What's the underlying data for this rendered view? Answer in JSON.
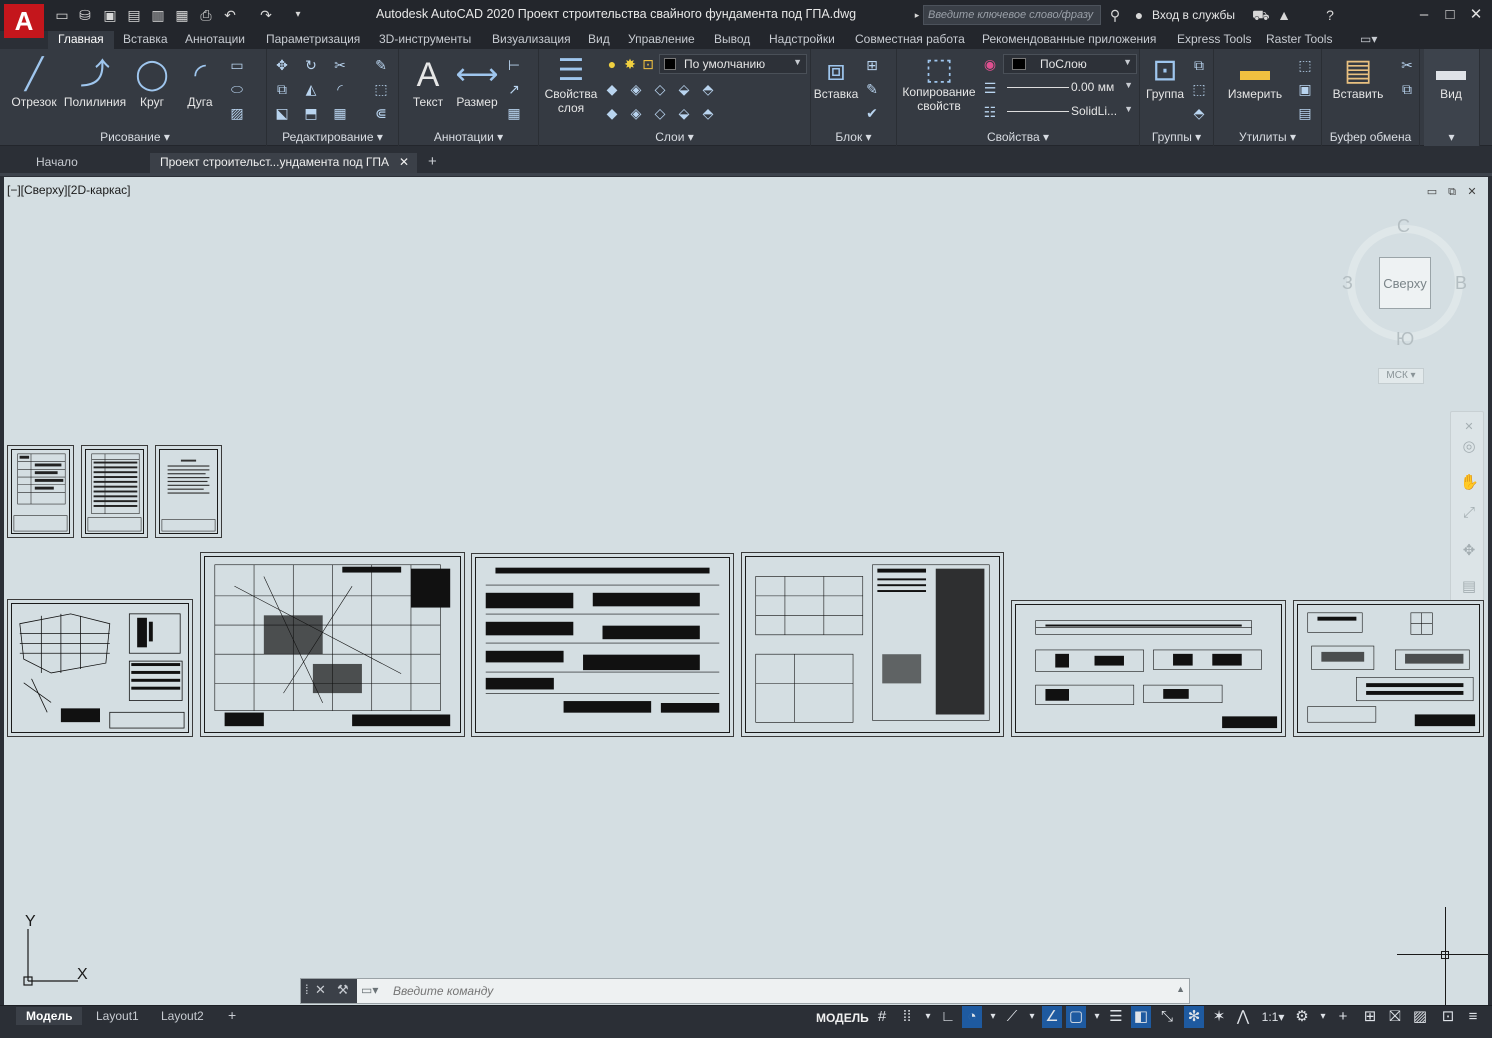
{
  "titlebar": {
    "app_logo": "A",
    "title": "Autodesk AutoCAD 2020   Проект строительства свайного фундамента под ГПА.dwg",
    "search_placeholder": "Введите ключевое слово/фразу",
    "sign_in": "Вход в службы"
  },
  "ribbon_tabs": [
    "Главная",
    "Вставка",
    "Аннотации",
    "Параметризация",
    "3D-инструменты",
    "Визуализация",
    "Вид",
    "Управление",
    "Вывод",
    "Надстройки",
    "Совместная работа",
    "Рекомендованные приложения",
    "Express Tools",
    "Raster Tools"
  ],
  "ribbon": {
    "draw": {
      "label": "Рисование",
      "tools": [
        "Отрезок",
        "Полилиния",
        "Круг",
        "Дуга"
      ]
    },
    "modify": {
      "label": "Редактирование"
    },
    "annotation": {
      "label": "Аннотации",
      "text": "Текст",
      "dimension": "Размер"
    },
    "layers": {
      "label": "Слои",
      "layer_props_1": "Свойства",
      "layer_props_2": "слоя",
      "current_layer": "По умолчанию"
    },
    "block": {
      "label": "Блок",
      "insert": "Вставка"
    },
    "properties": {
      "label": "Свойства",
      "match_1": "Копирование",
      "match_2": "свойств",
      "color": "ПоСлою",
      "lineweight": "0.00 мм",
      "linetype": "SolidLi..."
    },
    "groups": {
      "label": "Группы",
      "group": "Группа"
    },
    "utilities": {
      "label": "Утилиты",
      "measure": "Измерить"
    },
    "clipboard": {
      "label": "Буфер обмена",
      "paste": "Вставить"
    },
    "view": {
      "label": "Вид"
    }
  },
  "doc_tabs": [
    "Начало",
    "Проект строительст...ундамента под ГПА"
  ],
  "viewport": {
    "label": "[−][Сверху][2D-каркас]",
    "viewcube": {
      "face": "Сверху",
      "n": "С",
      "s": "Ю",
      "w": "З",
      "e": "В",
      "wcs": "МСК"
    }
  },
  "ucs": {
    "x": "X",
    "y": "Y"
  },
  "command": {
    "placeholder": "Введите команду"
  },
  "status": {
    "layout_tabs": [
      "Модель",
      "Layout1",
      "Layout2"
    ],
    "model": "МОДЕЛЬ",
    "scale": "1:1"
  },
  "colors": {
    "background": "#2b2f36",
    "canvas": "#d4dee2",
    "accent": "#1e5aa0",
    "logo": "#c4161c"
  }
}
